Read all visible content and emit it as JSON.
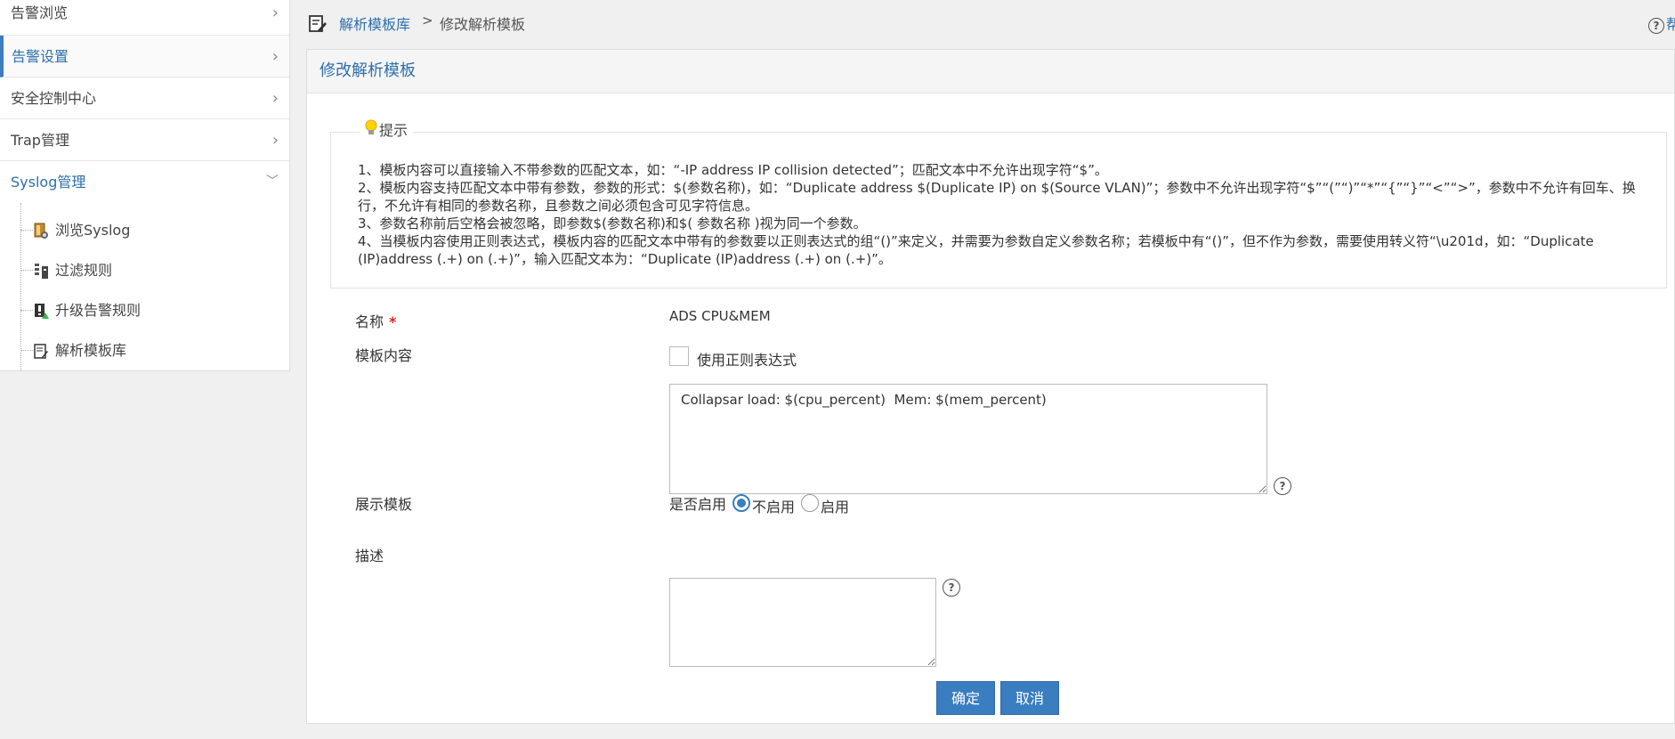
{
  "sidebar": {
    "items": [
      {
        "label": "告警浏览"
      },
      {
        "label": "告警设置"
      },
      {
        "label": "安全控制中心"
      },
      {
        "label": "Trap管理"
      },
      {
        "label": "Syslog管理"
      }
    ],
    "subitems": [
      {
        "label": "浏览Syslog",
        "icon": "browse-syslog-icon"
      },
      {
        "label": "过滤规则",
        "icon": "filter-rules-icon"
      },
      {
        "label": "升级告警规则",
        "icon": "upgrade-alarm-icon"
      },
      {
        "label": "解析模板库",
        "icon": "template-library-icon"
      }
    ]
  },
  "header": {
    "breadcrumb_link": "解析模板库",
    "breadcrumb_sep": ">",
    "breadcrumb_current": "修改解析模板",
    "help_label": "帮助"
  },
  "panel": {
    "title": "修改解析模板",
    "tips_title": "提示",
    "tips": [
      "1、模板内容可以直接输入不带参数的匹配文本，如：“-IP address IP collision detected”；匹配文本中不允许出现字符“$”。",
      "2、模板内容支持匹配文本中带有参数，参数的形式：$(参数名称)，如：“Duplicate address $(Duplicate IP) on $(Source VLAN)”；参数中不允许出现字符“$”“(”“)”“*”“{”“}”“<”“>”，参数中不允许有回车、换行，不允许有相同的参数名称，且参数之间必须包含可见字符信息。",
      "3、参数名称前后空格会被忽略，即参数$(参数名称)和$( 参数名称 )视为同一个参数。",
      "4、当模板内容使用正则表达式，模板内容的匹配文本中带有的参数要以正则表达式的组“()”来定义，并需要为参数自定义参数名称；若模板中有“()”，但不作为参数，需要使用转义符“\\u201d，如：“Duplicate (IP)address (.+) on (.+)”，输入匹配文本为：“Duplicate (IP)address (.+) on (.+)”。"
    ]
  },
  "form": {
    "name_label": "名称",
    "name_required": "*",
    "name_value": "ADS CPU&MEM",
    "content_label": "模板内容",
    "regex_checkbox_label": "使用正则表达式",
    "regex_checked": false,
    "content_value": "Collapsar load: $(cpu_percent)  Mem: $(mem_percent)",
    "display_label": "展示模板",
    "enable_prompt": "是否启用",
    "option_disable": "不启用",
    "option_enable": "启用",
    "selected_option": "不启用",
    "desc_label": "描述",
    "desc_value": "",
    "help_glyph": "?",
    "ok_label": "确定",
    "cancel_label": "取消"
  },
  "colors": {
    "accent": "#3a7dc0",
    "link": "#2d6fad",
    "required": "#d22222"
  }
}
